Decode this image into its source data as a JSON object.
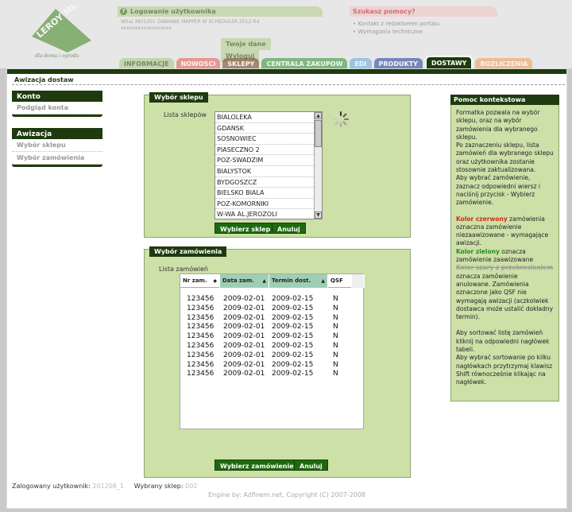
{
  "header": {
    "logo_text": "LEROY MERLIN",
    "logo_slogan": "dla domu i ogrodu",
    "login_title": "Logowanie użytkownika",
    "login_info_line1": "Witaj 3801201 ZABRANE MAPPER W SCHEDULER 2012-R4",
    "login_info_line2": "xxxxxxxxxxxxxxxxxx",
    "btn_your_data": "Twoje dane",
    "btn_logout": "Wyloguj",
    "help_title": "Szukasz pomocy?",
    "help_links": [
      "Kontakt z redaktorem portalu",
      "Wymagania techniczne"
    ]
  },
  "tabs": [
    {
      "label": "INFORMACJE",
      "bg": "#aacc88",
      "color": "#2a4a10"
    },
    {
      "label": "NOWOSCI",
      "bg": "#e8645a",
      "color": "#ffffff"
    },
    {
      "label": "SKLEPY",
      "bg": "#7a4a2a",
      "color": "#ffffff"
    },
    {
      "label": "CENTRALA ZAKUPOW",
      "bg": "#3a9a3a",
      "color": "#ffffff"
    },
    {
      "label": "EDI",
      "bg": "#6ab0e0",
      "color": "#ffffff"
    },
    {
      "label": "PRODUKTY",
      "bg": "#2a4a9a",
      "color": "#ffffff"
    },
    {
      "label": "DOSTAWY",
      "bg": "#1e3a0e",
      "color": "#ffffff"
    },
    {
      "label": "ROZLICZENIA",
      "bg": "#f0a060",
      "color": "#ffffff"
    }
  ],
  "page": {
    "title": "Awizacja dostaw"
  },
  "sidemenu": {
    "konto": {
      "title": "Konto",
      "items": [
        "Podgląd konta"
      ]
    },
    "awizacja": {
      "title": "Awizacja",
      "items": [
        "Wybór sklepu",
        "Wybór zamówienia"
      ]
    }
  },
  "store_panel": {
    "title": "Wybór sklepu",
    "list_label": "Lista sklepów",
    "stores": [
      "BIALOLEKA",
      "GDANSK",
      "SOSNOWIEC",
      "PIASECZNO 2",
      "POZ-SWADZIM",
      "BIALYSTOK",
      "BYDGOSZCZ",
      "BIELSKO BIALA",
      "POZ-KOMORNIKI",
      "W-WA AL.JEROZOLI"
    ],
    "btn_select": "Wybierz sklep",
    "btn_cancel": "Anuluj"
  },
  "order_panel": {
    "title": "Wybór zamówienia",
    "list_label": "Lista zamówień",
    "columns": [
      "Nr zam.",
      "Data zam.",
      "Termin dost.",
      "QSF"
    ],
    "rows": [
      [
        "123456",
        "2009-02-01",
        "2009-02-15",
        "N"
      ],
      [
        "123456",
        "2009-02-01",
        "2009-02-15",
        "N"
      ],
      [
        "123456",
        "2009-02-01",
        "2009-02-15",
        "N"
      ],
      [
        "123456",
        "2009-02-01",
        "2009-02-15",
        "N"
      ],
      [
        "123456",
        "2009-02-01",
        "2009-02-15",
        "N"
      ],
      [
        "123456",
        "2009-02-01",
        "2009-02-15",
        "N"
      ],
      [
        "123456",
        "2009-02-01",
        "2009-02-15",
        "N"
      ],
      [
        "123456",
        "2009-02-01",
        "2009-02-15",
        "N"
      ],
      [
        "123456",
        "2009-02-01",
        "2009-02-15",
        "N"
      ]
    ],
    "btn_select": "Wybierz zamówienie",
    "btn_cancel": "Anuluj"
  },
  "context_help": {
    "title": "Pomoc kontekstowa",
    "p1": "Formatka pozwala na wybór sklepu, oraz na wybór zamówienia dla wybranego sklepu.",
    "p2": "Po zaznaczeniu sklepu, lista zamówień dla wybranego sklepu oraz użytkownika zostanie stosownie zaktualizowana.",
    "p3": "Aby wybrać zamówienie, zaznacz odpowiedni wiersz i naciśnij przycisk - Wybierz zamówienie.",
    "red_label": "Kolor czerwony",
    "red_text": " zamówienia oznaczna zamówienie niezaawizowane - wymagające awizacji.",
    "green_label": "Kolor zielony",
    "green_text": " oznacza zamówienie zaawizowane",
    "grey_label": "Kolor szary z przekresleniem",
    "grey_text": " oznacza zamówienie anulowane. Zamówienia oznaczone jako QSF nie wymagają awizacji (aczkolwiek dostawca może ustalić dokładny termin).",
    "p4": "Aby sortować listę zamówień kliknij na odpowiedni nagłówek tabeli.",
    "p5": "Aby wybrać sortowanie po kilku nagłówkach przytrzymaj klawisz Shift równocześnie klikając na nagłówek."
  },
  "status": {
    "user_label": "Zalogowany użytkownik:",
    "user_value": "201208_1",
    "store_label": "Wybrany sklep:",
    "store_value": "002"
  },
  "footer": {
    "text": "Engine by: Adfinem.net, Copyright (C) 2007-2008"
  }
}
